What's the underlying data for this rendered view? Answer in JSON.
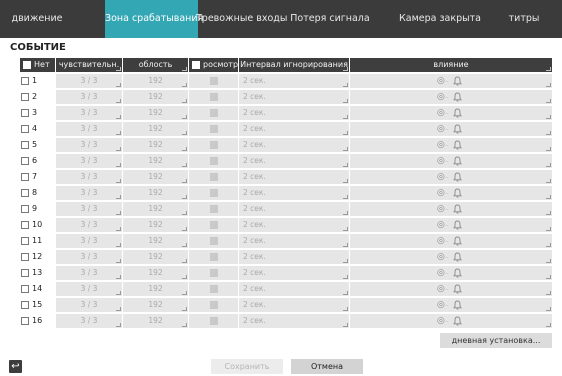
{
  "tabs": [
    {
      "label": "движение",
      "active": false
    },
    {
      "label": "Зона срабатывания",
      "active": true
    },
    {
      "label": "Тревожные входы",
      "active": false
    },
    {
      "label": "Потеря сигнала",
      "active": false
    },
    {
      "label": "Камера закрыта",
      "active": false
    },
    {
      "label": "титры",
      "active": false
    }
  ],
  "section_title": "СОБЫТИЕ",
  "table": {
    "headers": {
      "none": "Нет",
      "sensitivity": "чувствительн.",
      "area": "облость",
      "view": "росмотр",
      "interval": "Интервал игнорирования",
      "impact": "влияние"
    },
    "rows": [
      {
        "num": "1",
        "sensitivity": "3 / 3",
        "area": "192",
        "interval": "2 сек."
      },
      {
        "num": "2",
        "sensitivity": "3 / 3",
        "area": "192",
        "interval": "2 сек."
      },
      {
        "num": "3",
        "sensitivity": "3 / 3",
        "area": "192",
        "interval": "2 сек."
      },
      {
        "num": "4",
        "sensitivity": "3 / 3",
        "area": "192",
        "interval": "2 сек."
      },
      {
        "num": "5",
        "sensitivity": "3 / 3",
        "area": "192",
        "interval": "2 сек."
      },
      {
        "num": "6",
        "sensitivity": "3 / 3",
        "area": "192",
        "interval": "2 сек."
      },
      {
        "num": "7",
        "sensitivity": "3 / 3",
        "area": "192",
        "interval": "2 сек."
      },
      {
        "num": "8",
        "sensitivity": "3 / 3",
        "area": "192",
        "interval": "2 сек."
      },
      {
        "num": "9",
        "sensitivity": "3 / 3",
        "area": "192",
        "interval": "2 сек."
      },
      {
        "num": "10",
        "sensitivity": "3 / 3",
        "area": "192",
        "interval": "2 сек."
      },
      {
        "num": "11",
        "sensitivity": "3 / 3",
        "area": "192",
        "interval": "2 сек."
      },
      {
        "num": "12",
        "sensitivity": "3 / 3",
        "area": "192",
        "interval": "2 сек."
      },
      {
        "num": "13",
        "sensitivity": "3 / 3",
        "area": "192",
        "interval": "2 сек."
      },
      {
        "num": "14",
        "sensitivity": "3 / 3",
        "area": "192",
        "interval": "2 сек."
      },
      {
        "num": "15",
        "sensitivity": "3 / 3",
        "area": "192",
        "interval": "2 сек."
      },
      {
        "num": "16",
        "sensitivity": "3 / 3",
        "area": "192",
        "interval": "2 сек."
      }
    ],
    "impact_icons": [
      "camera-icon",
      "bell-icon"
    ]
  },
  "buttons": {
    "day_setup": "дневная установка...",
    "save": "Сохранить",
    "cancel": "Отмена"
  },
  "icons": {
    "back": "back-arrow-icon"
  },
  "colors": {
    "tabbar": "#3b3b3b",
    "tab_active": "#34a7b5",
    "header": "#3e3e3e",
    "cell": "#e6e6e6"
  }
}
